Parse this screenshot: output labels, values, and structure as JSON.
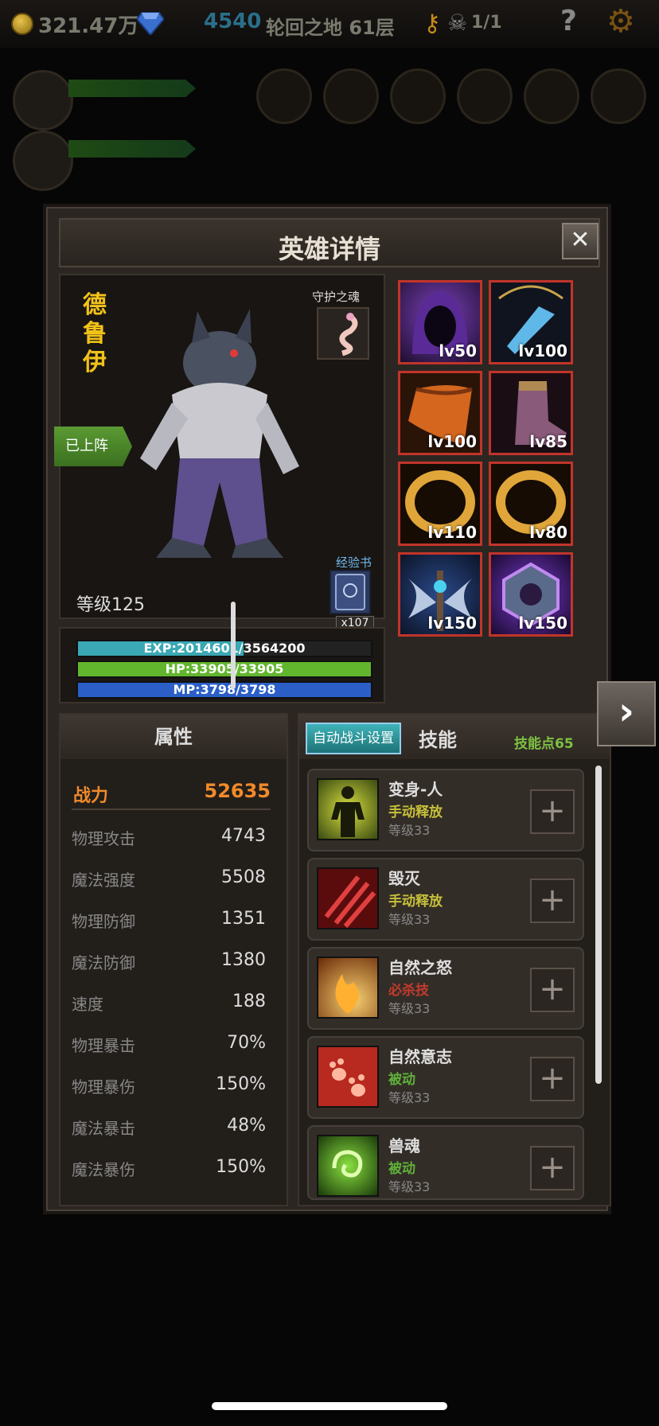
{
  "topbar": {
    "gold": "321.47万",
    "diamonds": "4540",
    "stage": "轮回之地 61层",
    "keys": "1/1",
    "help": "?"
  },
  "panel": {
    "title": "英雄详情",
    "close": "✕"
  },
  "hero": {
    "name_chars": [
      "德",
      "鲁",
      "伊"
    ],
    "guardian_label": "守护之魂",
    "deployed": "已上阵",
    "expbook_label": "经验书",
    "expbook_count": "x107",
    "level": "等级125",
    "exp": {
      "label": "EXP:2014601/3564200",
      "current": 2014601,
      "max": 3564200
    },
    "hp": {
      "label": "HP:33905/33905",
      "current": 33905,
      "max": 33905
    },
    "mp": {
      "label": "MP:3798/3798",
      "current": 3798,
      "max": 3798
    }
  },
  "equipment": [
    {
      "icon": "hood-icon",
      "level": "lv50"
    },
    {
      "icon": "pendant-icon",
      "level": "lv100"
    },
    {
      "icon": "cape-icon",
      "level": "lv100"
    },
    {
      "icon": "boots-icon",
      "level": "lv85"
    },
    {
      "icon": "ring-icon",
      "level": "lv110"
    },
    {
      "icon": "ring-icon",
      "level": "lv80"
    },
    {
      "icon": "axe-icon",
      "level": "lv150"
    },
    {
      "icon": "amulet-icon",
      "level": "lv150"
    }
  ],
  "attributes": {
    "title": "属性",
    "power_label": "战力",
    "power_value": "52635",
    "rows": [
      {
        "k": "物理攻击",
        "v": "4743"
      },
      {
        "k": "魔法强度",
        "v": "5508"
      },
      {
        "k": "物理防御",
        "v": "1351"
      },
      {
        "k": "魔法防御",
        "v": "1380"
      },
      {
        "k": "速度",
        "v": "188"
      },
      {
        "k": "物理暴击",
        "v": "70%"
      },
      {
        "k": "物理暴伤",
        "v": "150%"
      },
      {
        "k": "魔法暴击",
        "v": "48%"
      },
      {
        "k": "魔法暴伤",
        "v": "150%"
      }
    ]
  },
  "skills_panel": {
    "auto_button": "自动战斗设置",
    "title": "技能",
    "points": "技能点65",
    "skills": [
      {
        "name": "变身-人",
        "type": "手动释放",
        "type_color": "#c6c03a",
        "level": "等级33",
        "icon": "human-silhouette-icon"
      },
      {
        "name": "毁灭",
        "type": "手动释放",
        "type_color": "#c6c03a",
        "level": "等级33",
        "icon": "claw-slash-icon"
      },
      {
        "name": "自然之怒",
        "type": "必杀技",
        "type_color": "#c23b2c",
        "level": "等级33",
        "icon": "flame-icon"
      },
      {
        "name": "自然意志",
        "type": "被动",
        "type_color": "#5fb13a",
        "level": "等级33",
        "icon": "paw-icon"
      },
      {
        "name": "兽魂",
        "type": "被动",
        "type_color": "#5fb13a",
        "level": "等级33",
        "icon": "spirit-swirl-icon"
      }
    ],
    "plus": "+"
  },
  "colors": {
    "exp_bar": "#3aa8b5",
    "hp_bar": "#62b62e",
    "mp_bar": "#2b5fc7",
    "power": "#f08a2a",
    "equip_border": "#c2342a"
  }
}
